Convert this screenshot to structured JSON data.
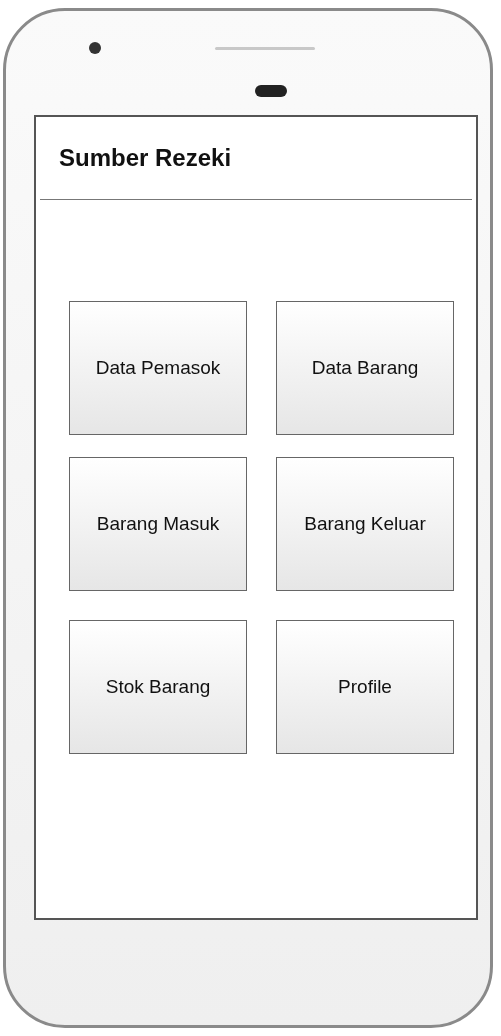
{
  "app_bar": {
    "title": "Sumber Rezeki"
  },
  "menu": [
    {
      "label": "Data Pemasok"
    },
    {
      "label": "Data Barang"
    },
    {
      "label": "Barang Masuk"
    },
    {
      "label": "Barang Keluar"
    },
    {
      "label": "Stok Barang"
    },
    {
      "label": "Profile"
    }
  ]
}
